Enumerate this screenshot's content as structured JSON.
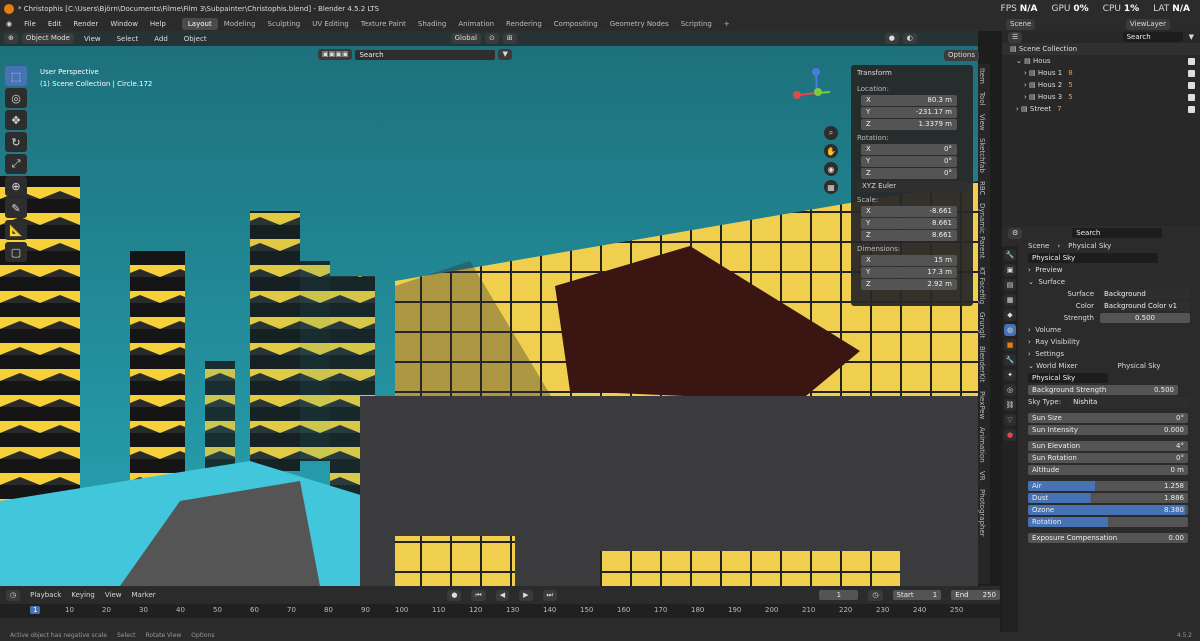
{
  "window": {
    "title": "* Christophis [C:\\Users\\Björn\\Documents\\Filme\\Film 3\\Subpainter\\Christophis.blend] - Blender 4.5.2 LTS",
    "stats": [
      {
        "label": "FPS",
        "value": "N/A"
      },
      {
        "label": "GPU",
        "value": "0%"
      },
      {
        "label": "CPU",
        "value": "1%"
      },
      {
        "label": "LAT",
        "value": "N/A"
      }
    ]
  },
  "menu": {
    "items": [
      "File",
      "Edit",
      "Render",
      "Window",
      "Help"
    ],
    "workspaces": [
      "Layout",
      "Modeling",
      "Sculpting",
      "UV Editing",
      "Texture Paint",
      "Shading",
      "Animation",
      "Rendering",
      "Compositing",
      "Geometry Nodes",
      "Scripting"
    ],
    "add_tab": "+",
    "scene": "Scene",
    "viewlayer": "ViewLayer"
  },
  "viewport": {
    "mode": "Object Mode",
    "menus": [
      "View",
      "Select",
      "Add",
      "Object"
    ],
    "orientation": "Global",
    "options": "Options",
    "info_line1": "User Perspective",
    "info_line2": "(1) Scene Collection | Circle.172",
    "search_placeholder": "Search"
  },
  "transform": {
    "title": "Transform",
    "location_label": "Location:",
    "location": [
      {
        "axis": "X",
        "value": "80.3 m"
      },
      {
        "axis": "Y",
        "value": "-231.17 m"
      },
      {
        "axis": "Z",
        "value": "1.3379 m"
      }
    ],
    "rotation_label": "Rotation:",
    "rotation": [
      {
        "axis": "X",
        "value": "0°"
      },
      {
        "axis": "Y",
        "value": "0°"
      },
      {
        "axis": "Z",
        "value": "0°"
      }
    ],
    "rotation_mode": "XYZ Euler",
    "scale_label": "Scale:",
    "scale": [
      {
        "axis": "X",
        "value": "-8.661"
      },
      {
        "axis": "Y",
        "value": "8.661"
      },
      {
        "axis": "Z",
        "value": "8.661"
      }
    ],
    "dimensions_label": "Dimensions:",
    "dimensions": [
      {
        "axis": "X",
        "value": "15 m"
      },
      {
        "axis": "Y",
        "value": "17.3 m"
      },
      {
        "axis": "Z",
        "value": "2.92 m"
      }
    ]
  },
  "sidebar_tabs": [
    "Item",
    "Tool",
    "View",
    "Sketchfab",
    "RBC",
    "Dynamic Parent",
    "KT Facefilg",
    "Grunglt",
    "BlenderKit",
    "PiexPew",
    "Animation",
    "VR",
    "Photographer"
  ],
  "outliner": {
    "search_placeholder": "Search",
    "root": "Scene Collection",
    "items": [
      {
        "name": "Hous",
        "indent": 1
      },
      {
        "name": "Hous 1",
        "indent": 2,
        "count": "8"
      },
      {
        "name": "Hous 2",
        "indent": 2,
        "count": "5"
      },
      {
        "name": "Hous 3",
        "indent": 2,
        "count": "5"
      },
      {
        "name": "Street",
        "indent": 1,
        "count": "7"
      }
    ]
  },
  "properties": {
    "search_placeholder": "Search",
    "breadcrumb_scene": "Scene",
    "breadcrumb_world": "Physical Sky",
    "world_name": "Physical Sky",
    "panels": {
      "preview": "Preview",
      "surface": "Surface",
      "volume": "Volume",
      "ray_visibility": "Ray Visibility",
      "settings": "Settings",
      "world_mixer": "World Mixer"
    },
    "surface_label": "Surface",
    "surface_value": "Background",
    "color_label": "Color",
    "color_value": "Background Color v1",
    "strength_label": "Strength",
    "strength_value": "0.500",
    "world_mixer_value": "Physical Sky",
    "node_name": "Physical Sky",
    "bg_strength_label": "Background Strength",
    "bg_strength_value": "0.500",
    "sky_type_label": "Sky Type:",
    "sky_type_value": "Nishita",
    "sun_rows": [
      {
        "label": "Sun Size",
        "value": "0°"
      },
      {
        "label": "Sun Intensity",
        "value": "0.000"
      }
    ],
    "sun_rows2": [
      {
        "label": "Sun Elevation",
        "value": "4°"
      },
      {
        "label": "Sun Rotation",
        "value": "0°"
      },
      {
        "label": "Altitude",
        "value": "0 m"
      }
    ],
    "atmo_rows": [
      {
        "label": "Air",
        "value": "1.258",
        "fill": 0.42
      },
      {
        "label": "Dust",
        "value": "1.886",
        "fill": 0.39
      },
      {
        "label": "Ozone",
        "value": "8.380",
        "fill": 0.98
      },
      {
        "label": "Rotation",
        "value": "",
        "fill": 0.5
      }
    ],
    "exposure_label": "Exposure Compensation",
    "exposure_value": "0.00"
  },
  "timeline": {
    "menus": [
      "Playback",
      "Keying",
      "View",
      "Marker"
    ],
    "current_frame": "1",
    "start_label": "Start",
    "start": "1",
    "end_label": "End",
    "end": "250",
    "ticks": [
      "1",
      "10",
      "20",
      "30",
      "40",
      "50",
      "60",
      "70",
      "80",
      "90",
      "100",
      "110",
      "120",
      "130",
      "140",
      "150",
      "160",
      "170",
      "180",
      "190",
      "200",
      "210",
      "220",
      "230",
      "240",
      "250"
    ]
  },
  "status": {
    "message": "Active object has negative scale",
    "select": "Select",
    "rotate": "Rotate View",
    "options": "Options",
    "version": "4.5.2"
  },
  "colors": {
    "accent": "#4772b3",
    "orange": "#e87d0d",
    "teal": "#1f8a9a",
    "yellow": "#f6d13a"
  }
}
